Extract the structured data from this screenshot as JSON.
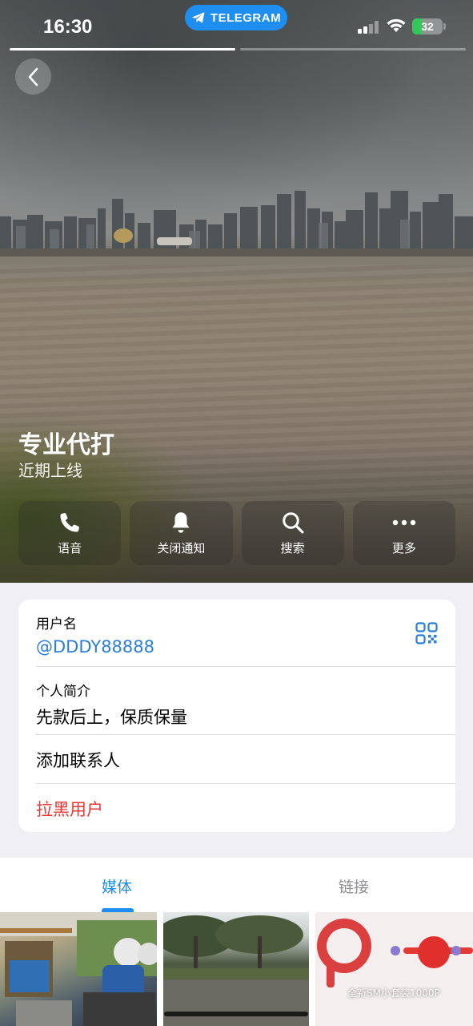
{
  "status_bar": {
    "time": "16:30",
    "app_pill": "TELEGRAM",
    "battery": "32",
    "battery_level": 0.32,
    "signal_icon": "cellular-signal-icon",
    "wifi_icon": "wifi-icon"
  },
  "story": {
    "segments": 2,
    "progress": [
      1.0,
      0.0
    ]
  },
  "header": {
    "back_icon": "chevron-left-icon",
    "name": "专业代打",
    "status": "近期上线"
  },
  "actions": [
    {
      "label": "语音",
      "icon": "phone-icon"
    },
    {
      "label": "关闭通知",
      "icon": "bell-icon"
    },
    {
      "label": "搜索",
      "icon": "search-icon"
    },
    {
      "label": "更多",
      "icon": "more-icon"
    }
  ],
  "info": {
    "username_label": "用户名",
    "username": "@DDDY88888",
    "qr_icon": "qr-code-icon",
    "bio_label": "个人简介",
    "bio": "先款后上，保质保量",
    "add_contact": "添加联系人",
    "block_user": "拉黑用户"
  },
  "tabs": [
    {
      "label": "媒体",
      "active": true
    },
    {
      "label": "链接",
      "active": false
    }
  ],
  "media": {
    "thumb3_caption": "全新SM小套装1000P"
  },
  "colors": {
    "link_blue": "#2a7fd4",
    "destructive_red": "#e53935",
    "telegram_blue": "#1f8ef1",
    "background": "#efeff4"
  }
}
